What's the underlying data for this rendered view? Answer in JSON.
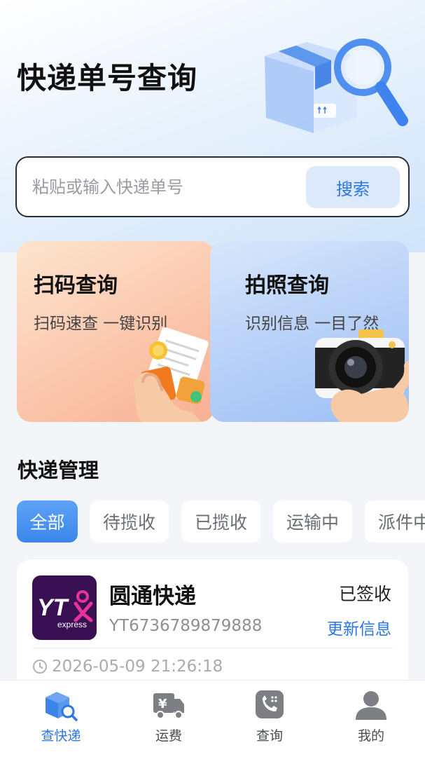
{
  "header": {
    "title": "快递单号查询"
  },
  "search": {
    "placeholder": "粘贴或输入快递单号",
    "button_label": "搜索"
  },
  "quick_cards": [
    {
      "title": "扫码查询",
      "subtitle": "扫码速查 一键识别"
    },
    {
      "title": "拍照查询",
      "subtitle": "识别信息 一目了然"
    }
  ],
  "management": {
    "title": "快递管理",
    "filters": [
      "全部",
      "待揽收",
      "已揽收",
      "运输中",
      "派件中"
    ],
    "active_filter": "全部"
  },
  "packages": [
    {
      "carrier": "圆通快递",
      "logo_text": "YT",
      "logo_sub": "express",
      "tracking_no": "YT6736789879888",
      "status": "已签收",
      "action": "更新信息",
      "time": "2026-05-09 21:26:18"
    }
  ],
  "tabbar": [
    {
      "label": "查快递",
      "icon": "package-search-icon",
      "active": true
    },
    {
      "label": "运费",
      "icon": "delivery-truck-icon",
      "active": false
    },
    {
      "label": "查询",
      "icon": "phone-icon",
      "active": false
    },
    {
      "label": "我的",
      "icon": "user-icon",
      "active": false
    }
  ],
  "colors": {
    "accent": "#2b76e5",
    "carrier_logo_bg": "#3a1054",
    "carrier_logo_accent": "#e8329a"
  }
}
